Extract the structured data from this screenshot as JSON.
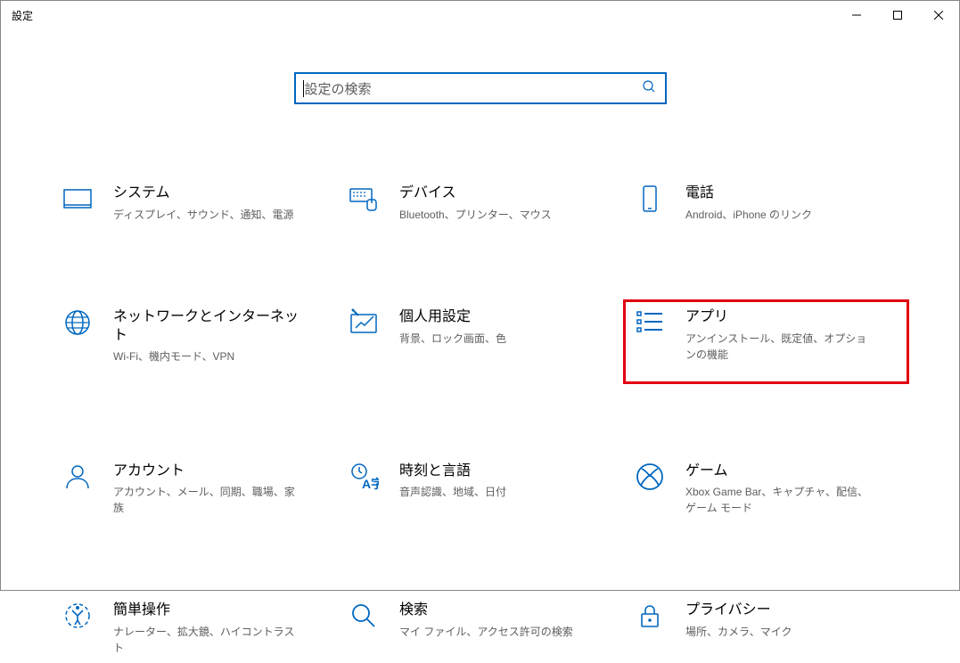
{
  "window": {
    "title": "設定"
  },
  "search": {
    "placeholder": "設定の検索"
  },
  "categories": [
    {
      "title": "システム",
      "desc": "ディスプレイ、サウンド、通知、電源"
    },
    {
      "title": "デバイス",
      "desc": "Bluetooth、プリンター、マウス"
    },
    {
      "title": "電話",
      "desc": "Android、iPhone のリンク"
    },
    {
      "title": "ネットワークとインターネット",
      "desc": "Wi-Fi、機内モード、VPN"
    },
    {
      "title": "個人用設定",
      "desc": "背景、ロック画面、色"
    },
    {
      "title": "アプリ",
      "desc": "アンインストール、既定値、オプションの機能"
    },
    {
      "title": "アカウント",
      "desc": "アカウント、メール、同期、職場、家族"
    },
    {
      "title": "時刻と言語",
      "desc": "音声認識、地域、日付"
    },
    {
      "title": "ゲーム",
      "desc": "Xbox Game Bar、キャプチャ、配信、ゲーム モード"
    },
    {
      "title": "簡単操作",
      "desc": "ナレーター、拡大鏡、ハイコントラスト"
    },
    {
      "title": "検索",
      "desc": "マイ ファイル、アクセス許可の検索"
    },
    {
      "title": "プライバシー",
      "desc": "場所、カメラ、マイク"
    }
  ]
}
